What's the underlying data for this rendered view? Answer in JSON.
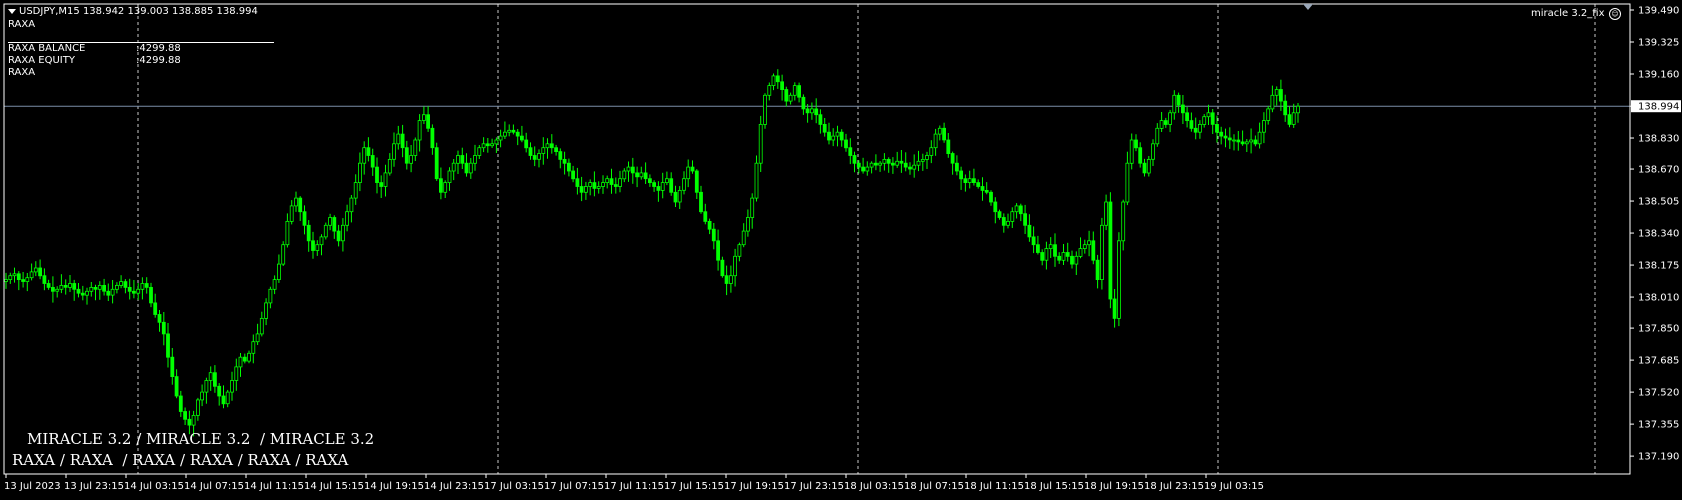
{
  "header": {
    "symbol_line": "USDJPY,M15  138.942 139.003 138.885 138.994",
    "indicator_name": "RAXA",
    "balance_label": "RAXA BALANCE",
    "balance_value": ":4299.88",
    "equity_label": "RAXA EQUITY",
    "equity_value": ":4299.88",
    "footer_label": "RAXA",
    "expert_label": "miracle 3.2_fix"
  },
  "watermark": {
    "line1": "MIRACLE 3.2 / MIRACLE 3.2  / MIRACLE 3.2",
    "line2": "RAXA / RAXA  / RAXA / RAXA / RAXA / RAXA"
  },
  "colors": {
    "background": "#000000",
    "candle": "#00ff00",
    "grid": "#c8c8c8",
    "bid_line": "#7b8ea8",
    "axis": "#ffffff"
  },
  "chart_data": {
    "type": "candlestick",
    "symbol": "USDJPY",
    "timeframe": "M15",
    "last_price": 138.994,
    "current_bar": {
      "open": 138.942,
      "high": 139.003,
      "low": 138.885,
      "close": 138.994
    },
    "ylim": [
      137.17,
      139.49
    ],
    "y_ticks": [
      "139.490",
      "139.325",
      "139.160",
      "138.994",
      "138.830",
      "138.670",
      "138.505",
      "138.340",
      "138.175",
      "138.010",
      "137.850",
      "137.685",
      "137.520",
      "137.355",
      "137.190"
    ],
    "x_ticks": [
      "13 Jul 2023",
      "13 Jul 23:15",
      "14 Jul 03:15",
      "14 Jul 07:15",
      "14 Jul 11:15",
      "14 Jul 15:15",
      "14 Jul 19:15",
      "14 Jul 23:15",
      "17 Jul 03:15",
      "17 Jul 07:15",
      "17 Jul 11:15",
      "17 Jul 15:15",
      "17 Jul 19:15",
      "17 Jul 23:15",
      "18 Jul 03:15",
      "18 Jul 07:15",
      "18 Jul 11:15",
      "18 Jul 15:15",
      "18 Jul 19:15",
      "18 Jul 23:15",
      "19 Jul 03:15"
    ],
    "session_separators": [
      "13 Jul 23:15",
      "14 Jul 23:15",
      "17 Jul 23:15",
      "18 Jul 23:15",
      "19 Jul 03:15"
    ],
    "closes": [
      138.1,
      138.12,
      138.13,
      138.1,
      138.09,
      138.11,
      138.14,
      138.16,
      138.12,
      138.08,
      138.06,
      138.04,
      138.05,
      138.07,
      138.06,
      138.08,
      138.05,
      138.03,
      138.02,
      138.04,
      138.06,
      138.05,
      138.07,
      138.04,
      138.02,
      138.05,
      138.07,
      138.09,
      138.06,
      138.04,
      138.03,
      138.05,
      138.08,
      138.06,
      137.98,
      137.92,
      137.88,
      137.82,
      137.7,
      137.6,
      137.5,
      137.42,
      137.38,
      137.35,
      137.4,
      137.48,
      137.52,
      137.58,
      137.62,
      137.55,
      137.5,
      137.46,
      137.52,
      137.58,
      137.65,
      137.7,
      137.68,
      137.72,
      137.78,
      137.82,
      137.9,
      137.98,
      138.05,
      138.1,
      138.18,
      138.28,
      138.4,
      138.48,
      138.52,
      138.45,
      138.38,
      138.3,
      138.25,
      138.28,
      138.32,
      138.38,
      138.42,
      138.35,
      138.3,
      138.38,
      138.45,
      138.52,
      138.6,
      138.7,
      138.78,
      138.74,
      138.68,
      138.6,
      138.58,
      138.65,
      138.72,
      138.8,
      138.85,
      138.78,
      138.7,
      138.74,
      138.82,
      138.92,
      138.95,
      138.88,
      138.78,
      138.62,
      138.55,
      138.6,
      138.66,
      138.7,
      138.74,
      138.7,
      138.65,
      138.7,
      138.74,
      138.78,
      138.8,
      138.79,
      138.8,
      138.82,
      138.84,
      138.86,
      138.87,
      138.86,
      138.84,
      138.82,
      138.78,
      138.74,
      138.72,
      138.75,
      138.78,
      138.8,
      138.78,
      138.76,
      138.72,
      138.7,
      138.66,
      138.62,
      138.58,
      138.55,
      138.58,
      138.6,
      138.57,
      138.58,
      138.6,
      138.62,
      138.59,
      138.58,
      138.62,
      138.66,
      138.68,
      138.65,
      138.63,
      138.65,
      138.62,
      138.6,
      138.58,
      138.56,
      138.6,
      138.62,
      138.55,
      138.5,
      138.56,
      138.62,
      138.68,
      138.66,
      138.55,
      138.45,
      138.4,
      138.36,
      138.3,
      138.2,
      138.12,
      138.08,
      138.12,
      138.22,
      138.28,
      138.35,
      138.42,
      138.52,
      138.7,
      138.9,
      139.05,
      139.1,
      139.15,
      139.12,
      139.08,
      139.02,
      139.05,
      139.1,
      139.04,
      138.98,
      138.96,
      138.98,
      138.95,
      138.9,
      138.86,
      138.82,
      138.84,
      138.86,
      138.82,
      138.78,
      138.74,
      138.7,
      138.68,
      138.66,
      138.68,
      138.7,
      138.69,
      138.7,
      138.72,
      138.7,
      138.69,
      138.71,
      138.7,
      138.68,
      138.67,
      138.69,
      138.71,
      138.72,
      138.74,
      138.78,
      138.85,
      138.88,
      138.82,
      138.75,
      138.7,
      138.66,
      138.62,
      138.6,
      138.62,
      138.6,
      138.58,
      138.56,
      138.55,
      138.5,
      138.45,
      138.42,
      138.38,
      138.4,
      138.45,
      138.48,
      138.44,
      138.38,
      138.32,
      138.28,
      138.24,
      138.2,
      138.26,
      138.28,
      138.22,
      138.2,
      138.24,
      138.22,
      138.18,
      138.22,
      138.26,
      138.28,
      138.3,
      138.2,
      138.1,
      138.38,
      138.5,
      138.0,
      137.9,
      138.3,
      138.5,
      138.7,
      138.82,
      138.78,
      138.7,
      138.65,
      138.72,
      138.8,
      138.88,
      138.92,
      138.9,
      138.96,
      139.05,
      139.0,
      138.96,
      138.92,
      138.88,
      138.86,
      138.9,
      138.94,
      138.96,
      138.9,
      138.86,
      138.84,
      138.83,
      138.82,
      138.82,
      138.81,
      138.8,
      138.81,
      138.82,
      138.8,
      138.86,
      138.92,
      138.98,
      139.05,
      139.08,
      139.02,
      138.95,
      138.9,
      138.96,
      138.994
    ]
  },
  "price_axis": {
    "labels": [
      "139.490",
      "139.325",
      "139.160",
      "138.994",
      "138.830",
      "138.670",
      "138.505",
      "138.340",
      "138.175",
      "138.010",
      "137.850",
      "137.685",
      "137.520",
      "137.355",
      "137.190"
    ]
  },
  "time_axis": {
    "labels": [
      "13 Jul 2023",
      "13 Jul 23:15",
      "14 Jul 03:15",
      "14 Jul 07:15",
      "14 Jul 11:15",
      "14 Jul 15:15",
      "14 Jul 19:15",
      "14 Jul 23:15",
      "17 Jul 03:15",
      "17 Jul 07:15",
      "17 Jul 11:15",
      "17 Jul 15:15",
      "17 Jul 19:15",
      "17 Jul 23:15",
      "18 Jul 03:15",
      "18 Jul 07:15",
      "18 Jul 11:15",
      "18 Jul 15:15",
      "18 Jul 19:15",
      "18 Jul 23:15",
      "19 Jul 03:15"
    ]
  }
}
